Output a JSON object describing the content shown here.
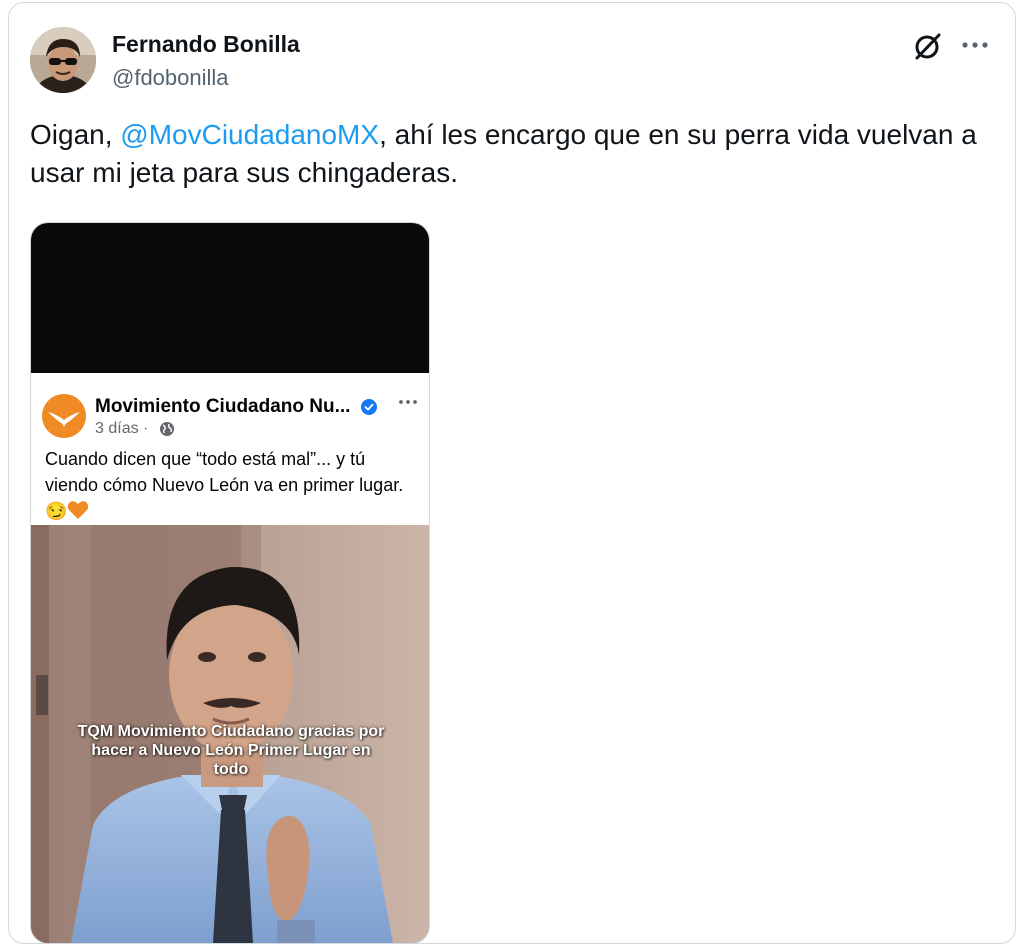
{
  "author": {
    "name": "Fernando Bonilla",
    "handle": "@fdobonilla"
  },
  "icons": {
    "header_action": "grok-icon",
    "more": "more-icon"
  },
  "tweet": {
    "text_before": "Oigan, ",
    "mention": "@MovCiudadanoMX",
    "text_after": ", ahí les encargo que en su perra vida vuelvan a usar mi jeta para sus chingaderas."
  },
  "embedded_post": {
    "page_name": "Movimiento Ciudadano Nu...",
    "time": "3 días ·",
    "text": "Cuando dicen que “todo está mal”... y tú viendo cómo Nuevo León va en primer lugar. 😏",
    "image_caption": "TQM Movimiento Ciudadano gracias por hacer a Nuevo León Primer Lugar en todo"
  },
  "colors": {
    "link": "#1d9bf0",
    "mc_orange": "#f08a24",
    "fb_verified": "#1877f2",
    "secondary_text": "#536471"
  }
}
